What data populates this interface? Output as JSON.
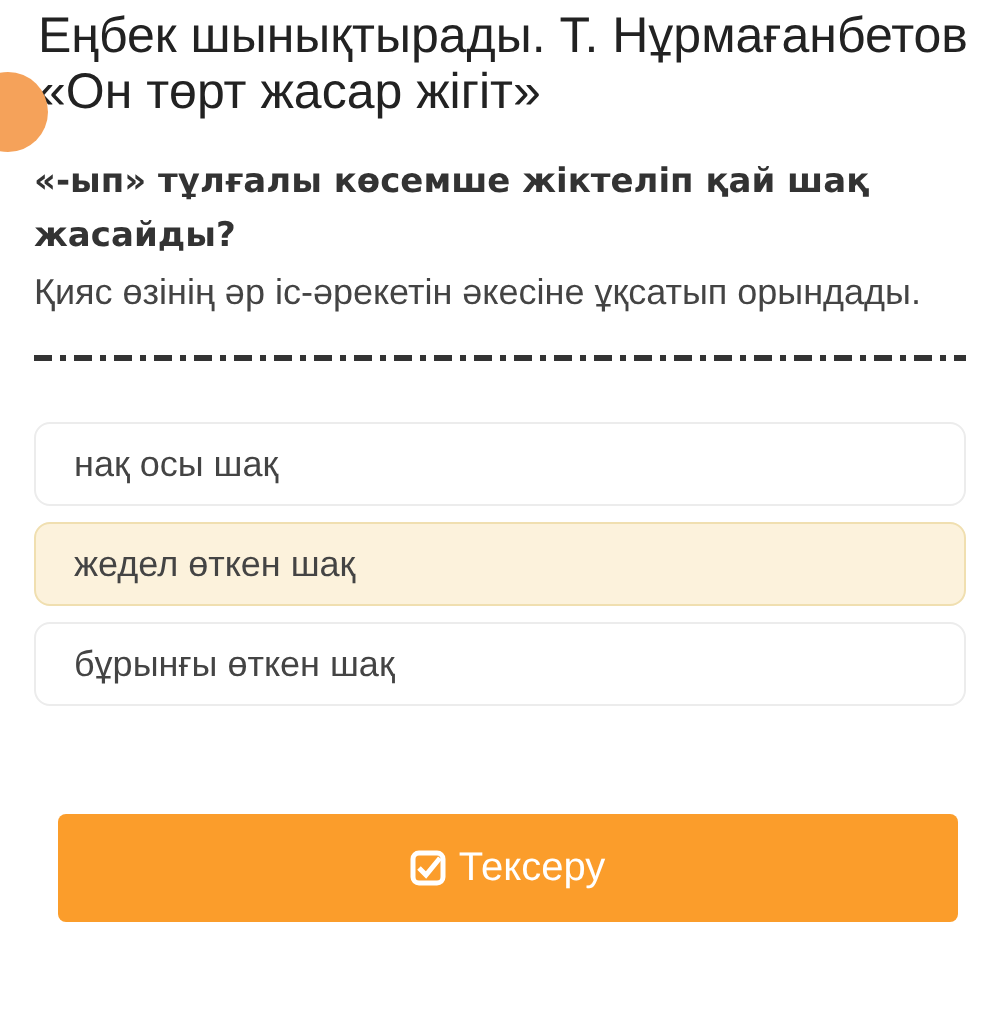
{
  "title": "Еңбек шынықтырады. Т. Нұрмағанбетов «Он төрт жасар жігіт»",
  "question": "«-ып» тұлғалы көсемше жіктеліп қай шақ жасайды?",
  "sentence": "Қияс өзінің әр іс-әрекетін әкесіне ұқсатып орындады.",
  "options": [
    {
      "label": "нақ осы шақ",
      "selected": false
    },
    {
      "label": "жедел өткен шақ",
      "selected": true
    },
    {
      "label": "бұрынғы өткен шақ",
      "selected": false
    }
  ],
  "check_button": "Тексеру"
}
